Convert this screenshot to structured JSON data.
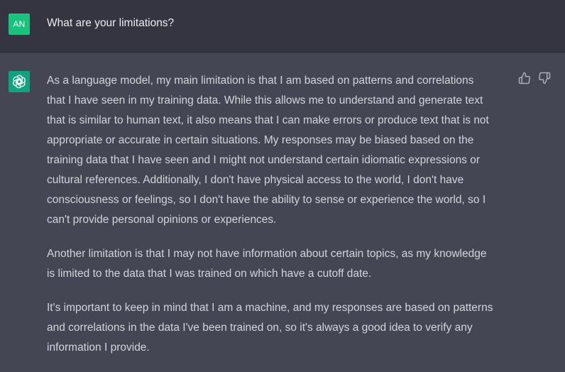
{
  "colors": {
    "user_avatar_bg": "#19c37d",
    "bot_avatar_bg": "#10a37f"
  },
  "user": {
    "avatar_initials": "AN",
    "message": "What are your limitations?"
  },
  "assistant": {
    "avatar_icon": "openai-logo-icon",
    "paragraphs": [
      [
        "As a language model, my main limitation is that I am based on patterns and correlations",
        "that I have seen in my training data. While this allows me to understand and generate text",
        "that is similar to human text, it also means that I can make errors or produce text that is not",
        "appropriate or accurate in certain situations. My responses may be biased based on the",
        "training data that I have seen and I might not understand certain idiomatic expressions or",
        "cultural references. Additionally, I don't have physical access to the world, I don't have",
        "consciousness or feelings, so I don't have the ability to sense or experience the world, so I",
        "can't provide personal opinions or experiences."
      ],
      [
        "Another limitation is that I may not have information about certain topics, as my knowledge",
        "is limited to the data that I was trained on which have a cutoff date."
      ],
      [
        "It's important to keep in mind that I am a machine, and my responses are based on patterns",
        "and correlations in the data I've been trained on, so it's always a good idea to verify any",
        "information I provide."
      ]
    ],
    "feedback": {
      "thumbs_up_icon": "thumbs-up-icon",
      "thumbs_down_icon": "thumbs-down-icon"
    }
  }
}
